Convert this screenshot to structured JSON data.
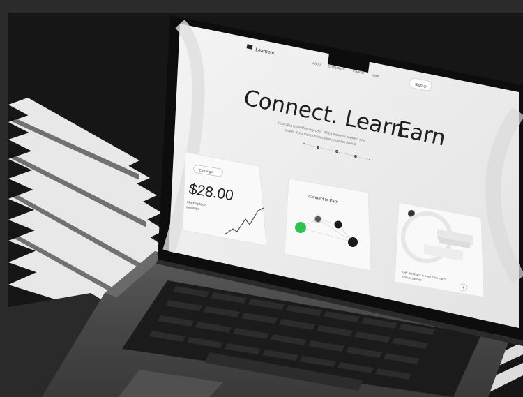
{
  "site": {
    "brand": "Leameon",
    "nav": [
      "About",
      "Ecosystem",
      "Partner",
      "Join"
    ],
    "cta_label": "Signup",
    "headline_part1": "Connect. Learn.",
    "headline_part2": "Earn",
    "subtitle_line1": "Your idea is worth every cent. With Leameon connect and",
    "subtitle_line2": "share. Build more connections and earn from it"
  },
  "cards": {
    "earnings": {
      "badge": "Earnings",
      "amount": "$28.00",
      "caption_line1": "Marketplace",
      "caption_line2": "earnings"
    },
    "connections": {
      "title": "Connect to Earn"
    },
    "chat": {
      "caption_line1": "Get feedback & earn from each",
      "caption_line2": "conversations"
    }
  },
  "colors": {
    "background": "#161616",
    "screen": "#ececec",
    "card": "#f7f7f7",
    "accent_green": "#2fc24d",
    "dark_node": "#1a1a1a"
  }
}
